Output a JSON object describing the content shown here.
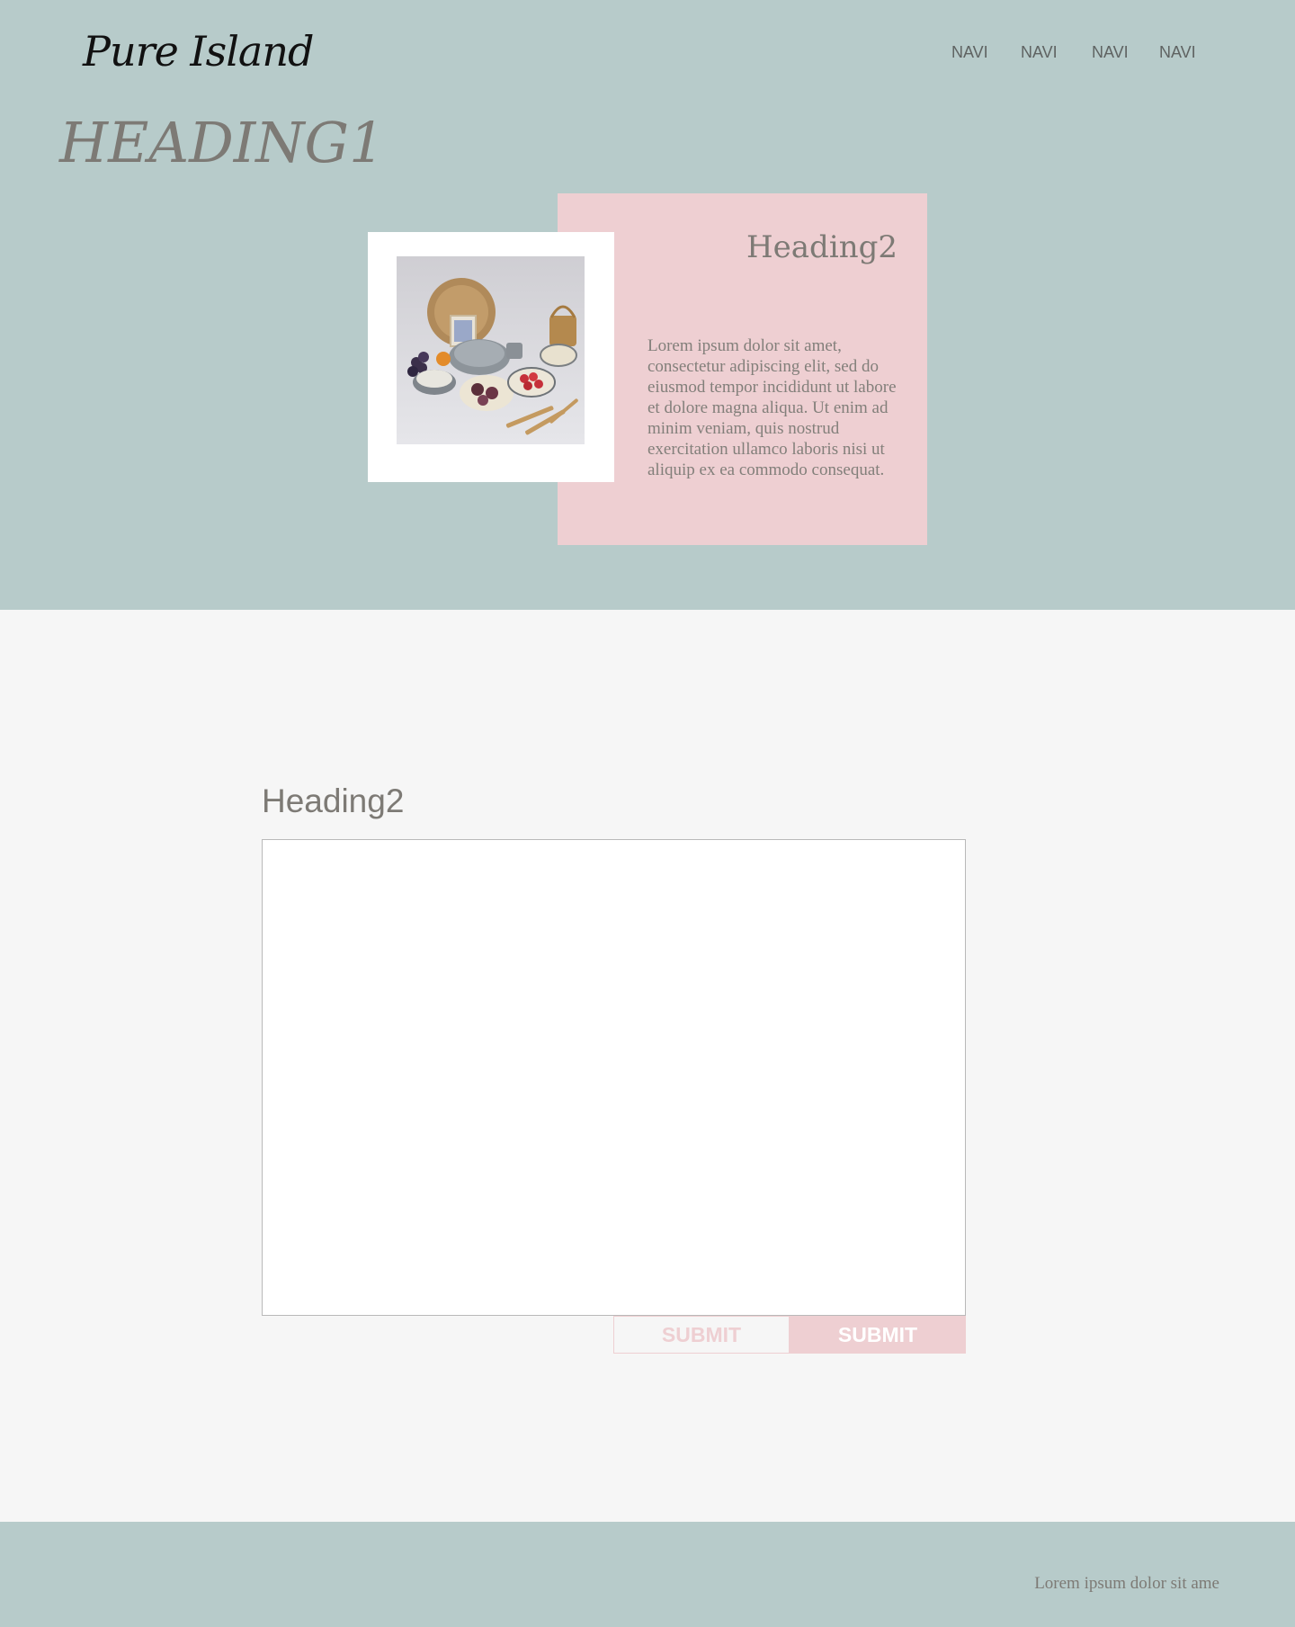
{
  "header": {
    "logo": "Pure Island",
    "nav": [
      "NAVI",
      "NAVI",
      "NAVI",
      "NAVI"
    ]
  },
  "hero": {
    "heading1": "HEADING1",
    "card": {
      "heading2": "Heading2",
      "text": "Lorem ipsum dolor sit amet, consectetur adipiscing elit, sed do eiusmod tempor incididunt ut labore et dolore magna aliqua. Ut enim ad minim veniam, quis nostrud exercitation ullamco laboris nisi ut aliquip ex ea commodo consequat."
    }
  },
  "form": {
    "heading2": "Heading2",
    "textarea_value": "",
    "submit_outline_label": "SUBMIT",
    "submit_filled_label": "SUBMIT"
  },
  "footer": {
    "text": "Lorem ipsum dolor sit ame"
  },
  "colors": {
    "teal_background": "#b7cbca",
    "pink_accent": "#eecfd2",
    "heading_gray": "#7d7a75",
    "page_background": "#f6f6f6"
  }
}
